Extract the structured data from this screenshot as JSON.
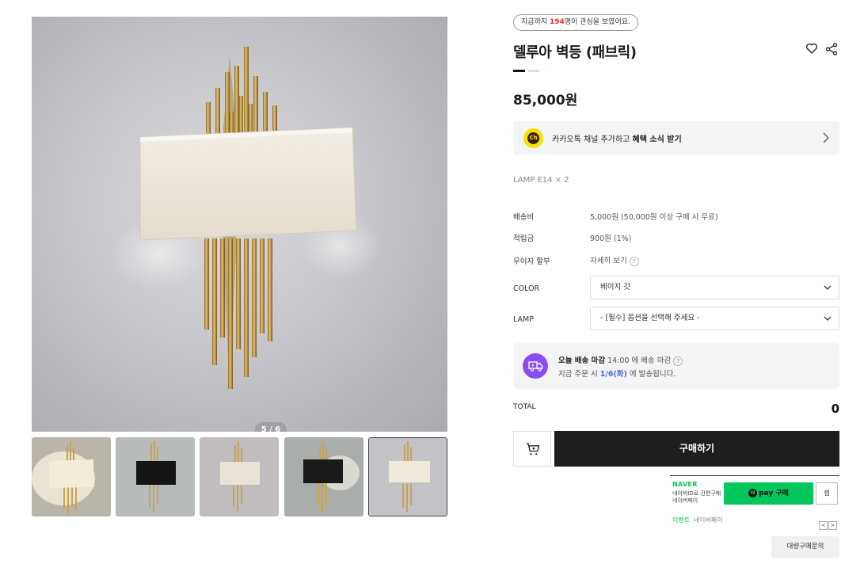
{
  "gallery": {
    "page_indicator": "5 / 6",
    "main_image_icon": "wall-sconce-gold-rods-beige-shade",
    "thumbnails": [
      {
        "icon": "wall-sconce-lit-beige-shade"
      },
      {
        "icon": "wall-sconce-black-shade"
      },
      {
        "icon": "wall-sconce-beige-shade"
      },
      {
        "icon": "wall-sconce-black-shade-lit"
      },
      {
        "icon": "wall-sconce-beige-shade-selected"
      }
    ]
  },
  "product": {
    "interest_prefix": "지금까지 ",
    "interest_count": "194",
    "interest_suffix": "명이 관심을 보였어요.",
    "title": "델루아 벽등 (패브릭)",
    "price": "85,000원",
    "spec": "LAMP E14 × 2",
    "swatches": [
      "#111111",
      "#efe6d3"
    ]
  },
  "kakao": {
    "logo_text": "Ch",
    "text_prefix": "카카오톡 채널 추가하고 ",
    "text_bold": "혜택 소식 받기"
  },
  "info": {
    "shipping_label": "배송비",
    "shipping_value": "5,000원 (50,000원 이상 구매 시 무료)",
    "points_label": "적립금",
    "points_value": "900원 (1%)",
    "installment_label": "무이자 할부",
    "installment_value": "자세히 보기",
    "help_glyph": "?"
  },
  "options": {
    "color_label": "COLOR",
    "color_value": "베이지 갓",
    "lamp_label": "LAMP",
    "lamp_value": "- [필수] 옵션을 선택해 주세요 -"
  },
  "delivery": {
    "title": "오늘 배송 마감",
    "cutoff": " 14:00 에 배송 마감",
    "line2_prefix": "지금 주문 시 ",
    "date": "1/6(화)",
    "line2_suffix": " 에 발송됩니다."
  },
  "total": {
    "label": "TOTAL",
    "value": "0"
  },
  "actions": {
    "buy_label": "구매하기",
    "bulk_label": "대량구매문의"
  },
  "npay": {
    "brand": "NAVER",
    "desc_line1": "네이버ID로 간편구매",
    "desc_line2": "네이버페이",
    "pay_label": "pay 구매",
    "pay_dot": "N",
    "zzim_label": "찜",
    "event_label": "이벤트",
    "event_sub": "네이버페이",
    "prev": "<",
    "next": ">"
  },
  "colors": {
    "accent_red": "#e8332a",
    "kakao_yellow": "#fae100",
    "delivery_purple": "#8c4df0",
    "date_blue": "#4a6cd8",
    "naver_green": "#03c75a",
    "buy_black": "#1e1e1e"
  }
}
